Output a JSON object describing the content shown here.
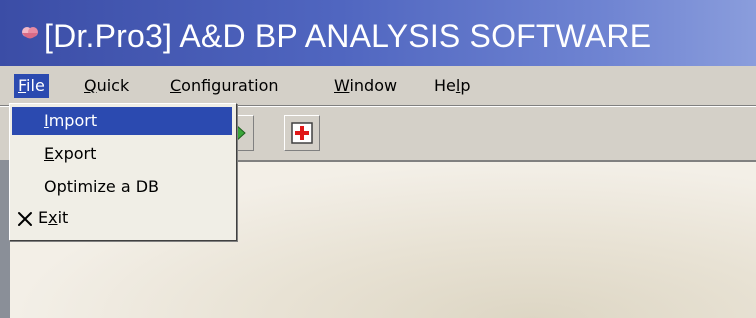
{
  "window": {
    "title": "[Dr.Pro3] A&D BP ANALYSIS SOFTWARE",
    "title_bar_color": "#3b4da6"
  },
  "menubar": {
    "items": [
      {
        "label_mnemonic": "F",
        "label_rest": "ile",
        "state": "open"
      },
      {
        "label_mnemonic": "Q",
        "label_rest": "uick"
      },
      {
        "label_mnemonic": "C",
        "label_rest": "onfiguration"
      },
      {
        "label_mnemonic": "W",
        "label_rest": "indow"
      },
      {
        "label_pre": "He",
        "label_mnemonic": "l",
        "label_rest": "p"
      }
    ]
  },
  "toolbar": {
    "buttons": [
      {
        "icon": "green-arrow-icon"
      },
      {
        "icon": "red-cross-icon"
      }
    ]
  },
  "file_menu": {
    "items": [
      {
        "mnemonic": "I",
        "rest": "mport",
        "selected": true
      },
      {
        "mnemonic": "E",
        "rest": "xport"
      },
      {
        "label": "Optimize a DB"
      },
      {
        "pre": "E",
        "mnemonic": "x",
        "rest": "it",
        "icon": "close-x-icon"
      }
    ]
  },
  "colors": {
    "menu_highlight": "#2b4ab0",
    "chrome": "#d4d0c8",
    "accent_red": "#e01818"
  }
}
